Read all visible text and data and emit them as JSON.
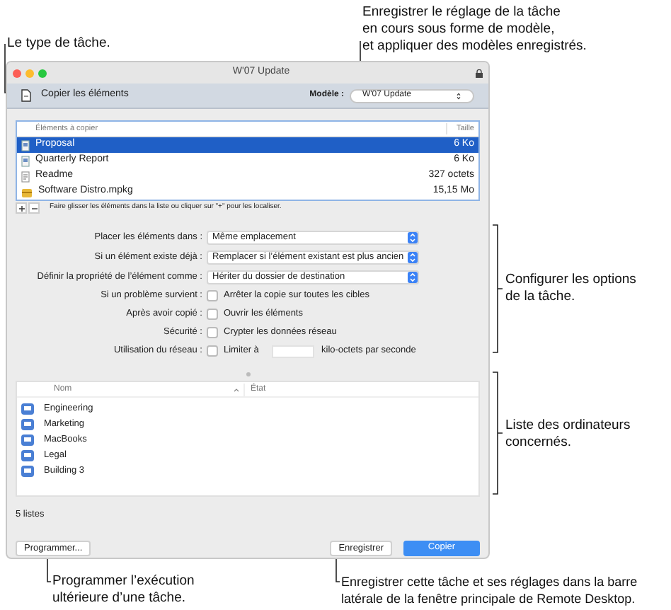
{
  "callouts": {
    "task_type": {
      "lines": [
        "Le type de tâche."
      ]
    },
    "template": {
      "lines": [
        "Enregistrer le réglage de la tâche",
        "en cours sous forme de modèle,",
        "et appliquer des modèles enregistrés."
      ]
    },
    "options": {
      "lines": [
        "Configurer les options",
        "de la tâche."
      ]
    },
    "computers": {
      "lines": [
        "Liste des ordinateurs",
        "concernés."
      ]
    },
    "schedule": {
      "lines": [
        "Programmer l’exécution",
        "ultérieure d’une tâche."
      ]
    },
    "save": {
      "lines": [
        "Enregistrer cette tâche et ses réglages dans la barre",
        "latérale de la fenêtre principale de Remote Desktop."
      ]
    }
  },
  "window": {
    "title": "W'07 Update",
    "task": "Copier les éléments",
    "template_label": "Modèle :",
    "template_value": "W'07 Update"
  },
  "items_table": {
    "columns": [
      "Éléments à copier",
      "Taille"
    ],
    "rows": [
      {
        "name": "Proposal",
        "size": "6 Ko",
        "kind": "document",
        "selected": true
      },
      {
        "name": "Quarterly Report",
        "size": "6 Ko",
        "kind": "document",
        "selected": false
      },
      {
        "name": "Readme",
        "size": "327 octets",
        "kind": "text",
        "selected": false
      },
      {
        "name": "Software Distro.mpkg",
        "size": "15,15 Mo",
        "kind": "package",
        "selected": false
      }
    ]
  },
  "hint": "Faire glisser les éléments dans la liste ou cliquer sur \"+\" pour les localiser.",
  "options": [
    {
      "kind": "select",
      "label": "Placer les éléments dans :",
      "value": "Même emplacement"
    },
    {
      "kind": "select",
      "label": "Si un élément existe déjà :",
      "value": "Remplacer si l’élément existant est plus ancien"
    },
    {
      "kind": "select",
      "label": "Définir la propriété de l’élément comme :",
      "value": "Hériter du dossier de destination"
    },
    {
      "kind": "checkbox",
      "label": "Si un problème survient :",
      "text": "Arrêter la copie sur toutes les cibles",
      "checked": false
    },
    {
      "kind": "checkbox",
      "label": "Après avoir copié :",
      "text": "Ouvrir les éléments",
      "checked": false
    },
    {
      "kind": "checkbox",
      "label": "Sécurité :",
      "text": "Crypter les données réseau",
      "checked": false
    },
    {
      "kind": "limit",
      "label": "Utilisation du réseau :",
      "text": "Limiter à",
      "unit": "kilo-octets par seconde",
      "checked": false
    }
  ],
  "computers": {
    "columns": [
      "Nom",
      "État"
    ],
    "rows": [
      {
        "name": "Engineering"
      },
      {
        "name": "Marketing"
      },
      {
        "name": "MacBooks"
      },
      {
        "name": "Legal"
      },
      {
        "name": "Building 3"
      }
    ]
  },
  "status": "5 listes",
  "buttons": [
    {
      "label": "Programmer...",
      "kind": "secondary"
    },
    {
      "label": "Enregistrer",
      "kind": "secondary"
    },
    {
      "label": "Copier",
      "kind": "primary"
    }
  ]
}
